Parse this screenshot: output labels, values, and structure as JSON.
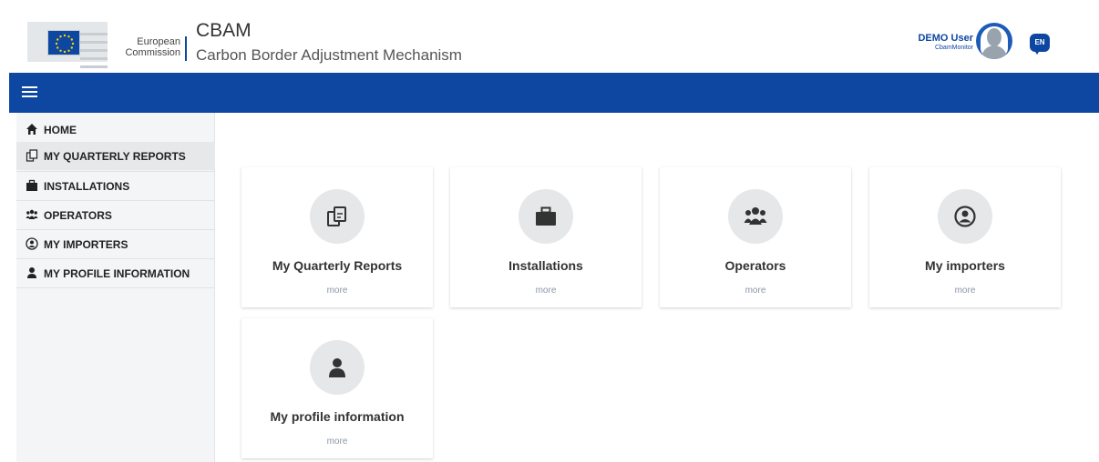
{
  "header": {
    "logo_text_line1": "European",
    "logo_text_line2": "Commission",
    "app_title": "CBAM",
    "app_subtitle": "Carbon Border Adjustment Mechanism",
    "user_name": "DEMO User",
    "user_role": "CbamMonitor",
    "language": "EN"
  },
  "navbar": {
    "menu_icon": "hamburger-icon",
    "color": "#0e47a1"
  },
  "sidebar": {
    "items": [
      {
        "label": "HOME",
        "icon": "home-icon"
      },
      {
        "label": "MY QUARTERLY REPORTS",
        "icon": "reports-icon",
        "active": true
      },
      {
        "label": "INSTALLATIONS",
        "icon": "briefcase-icon"
      },
      {
        "label": "OPERATORS",
        "icon": "users-icon"
      },
      {
        "label": "MY IMPORTERS",
        "icon": "user-circle-icon"
      },
      {
        "label": "MY PROFILE INFORMATION",
        "icon": "user-icon"
      }
    ]
  },
  "cards": [
    {
      "title": "My Quarterly Reports",
      "more": "more",
      "icon": "reports-icon"
    },
    {
      "title": "Installations",
      "more": "more",
      "icon": "briefcase-icon"
    },
    {
      "title": "Operators",
      "more": "more",
      "icon": "users-icon"
    },
    {
      "title": "My importers",
      "more": "more",
      "icon": "user-circle-icon"
    },
    {
      "title": "My profile information",
      "more": "more",
      "icon": "user-icon"
    }
  ]
}
